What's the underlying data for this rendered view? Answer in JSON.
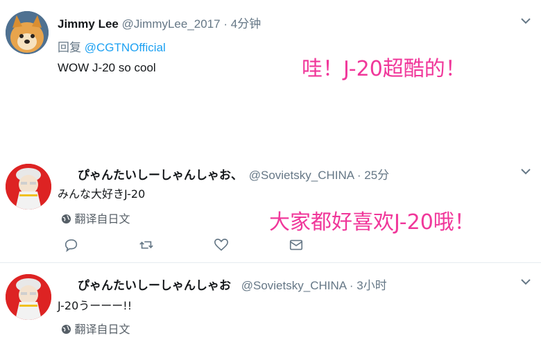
{
  "tweets": [
    {
      "name": "Jimmy Lee",
      "handle": "@JimmyLee_2017",
      "time": "· 4分钟",
      "reply_prefix": "回复",
      "reply_to": "@CGTNOfficial",
      "text": "WOW J-20 so cool",
      "annotation": "哇！J-20超酷的！"
    },
    {
      "name": "ぴゃんたいしーしゃんしゃお、",
      "handle": "@Sovietsky_CHINA",
      "time": "· 25分",
      "text": "みんな大好きJ-20",
      "translate_label": "翻译自日文",
      "annotation": "大家都好喜欢J-20哦！"
    },
    {
      "name": "ぴゃんたいしーしゃんしゃお",
      "handle": "@Sovietsky_CHINA",
      "time": "· 3小时",
      "text": "J-20うーーー!!",
      "translate_label": "翻译自日文"
    }
  ],
  "icons": {
    "dropdown": "chevron-down-icon",
    "globe": "globe-icon",
    "reply": "reply-icon",
    "retweet": "retweet-icon",
    "like": "heart-icon",
    "dm": "envelope-icon"
  },
  "colors": {
    "annotation": "#f0379a",
    "link": "#1da1f2",
    "secondary_text": "#657786"
  }
}
